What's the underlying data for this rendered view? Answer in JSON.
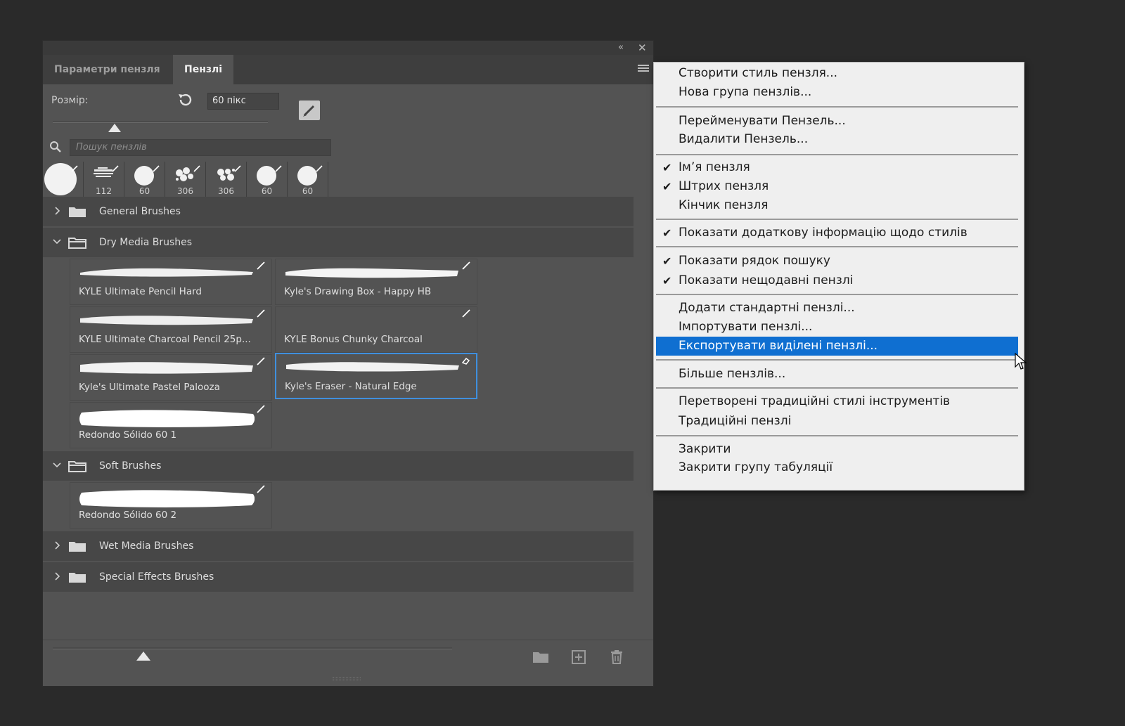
{
  "panel": {
    "tabs": [
      {
        "label": "Параметри пензля"
      },
      {
        "label": "Пензлі"
      }
    ],
    "size_label": "Розмір:",
    "size_value": "60 пікс",
    "search_placeholder": "Пошук пензлів",
    "recent_brushes": [
      {
        "size": ""
      },
      {
        "size": "112"
      },
      {
        "size": "60"
      },
      {
        "size": "306"
      },
      {
        "size": "306"
      },
      {
        "size": "60"
      },
      {
        "size": "60"
      }
    ],
    "groups": {
      "general": "General Brushes",
      "dry": "Dry Media Brushes",
      "soft": "Soft Brushes",
      "wet": "Wet Media Brushes",
      "special": "Special Effects Brushes"
    },
    "dry_brushes": [
      "KYLE Ultimate Pencil Hard",
      "Kyle's Drawing Box - Happy HB",
      "KYLE Ultimate Charcoal Pencil 25p...",
      "KYLE Bonus Chunky Charcoal",
      "Kyle's Ultimate Pastel Palooza",
      "Kyle's Eraser - Natural Edge",
      "Redondo Sólido 60 1"
    ],
    "soft_brushes": [
      "Redondo Sólido 60 2"
    ]
  },
  "menu": {
    "items": [
      {
        "label": "Створити стиль пензля...",
        "checked": false
      },
      {
        "label": "Нова група пензлів...",
        "checked": false
      },
      {
        "label": "Перейменувати Пензель...",
        "checked": false
      },
      {
        "label": "Видалити Пензель...",
        "checked": false
      },
      {
        "label": "Ім’я пензля",
        "checked": true
      },
      {
        "label": "Штрих пензля",
        "checked": true
      },
      {
        "label": "Кінчик пензля",
        "checked": false
      },
      {
        "label": "Показати додаткову інформацію щодо стилів",
        "checked": true
      },
      {
        "label": "Показати рядок пошуку",
        "checked": true
      },
      {
        "label": "Показати нещодавні пензлі",
        "checked": true
      },
      {
        "label": "Додати стандартні пензлі...",
        "checked": false
      },
      {
        "label": "Імпортувати пензлі...",
        "checked": false
      },
      {
        "label": "Експортувати виділені пензлі...",
        "checked": false,
        "highlighted": true
      },
      {
        "label": "Більше пензлів...",
        "checked": false
      },
      {
        "label": "Перетворені традиційні стилі інструментів",
        "checked": false
      },
      {
        "label": "Традиційні пензлі",
        "checked": false
      },
      {
        "label": "Закрити",
        "checked": false
      },
      {
        "label": "Закрити групу табуляції",
        "checked": false
      }
    ],
    "check_glyph": "✔"
  },
  "colors": {
    "highlight": "#0f6fd1",
    "selection_border": "#3f8fde",
    "panel_bg": "#535353"
  }
}
